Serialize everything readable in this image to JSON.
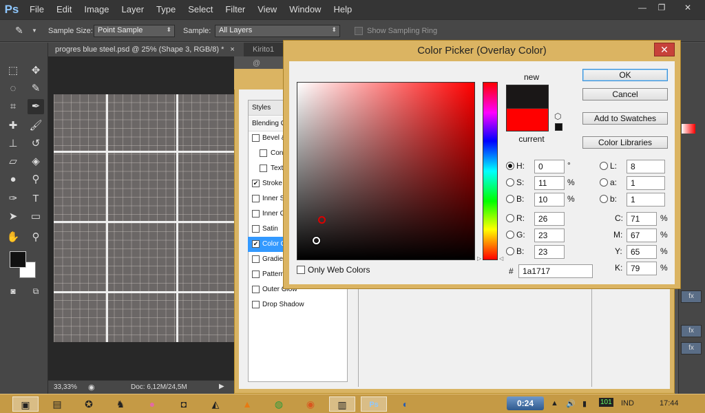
{
  "app": {
    "logo": "Ps",
    "menu": [
      "File",
      "Edit",
      "Image",
      "Layer",
      "Type",
      "Select",
      "Filter",
      "View",
      "Window",
      "Help"
    ],
    "window_buttons": [
      "minimize-icon",
      "restore-icon",
      "close-icon"
    ]
  },
  "options_bar": {
    "tool_icon": "eyedropper-icon",
    "sample_size_label": "Sample Size:",
    "sample_size_value": "Point Sample",
    "sample_label": "Sample:",
    "sample_value": "All Layers",
    "show_ring_label": "Show Sampling Ring",
    "show_ring_checked": false
  },
  "tabs": [
    {
      "label": "progres blue steel.psd @ 25% (Shape 3, RGB/8) *",
      "close": "×"
    },
    {
      "label": "Kirito1 @",
      "close": ""
    }
  ],
  "status": {
    "zoom": "33,33%",
    "doc": "Doc: 6,12M/24,5M"
  },
  "layer_style": {
    "styles_header": "Styles",
    "blending_label": "Blending O",
    "items": [
      {
        "label": "Bevel &",
        "checked": false,
        "indent": false
      },
      {
        "label": "Cont",
        "checked": false,
        "indent": true
      },
      {
        "label": "Text",
        "checked": false,
        "indent": true
      },
      {
        "label": "Stroke",
        "checked": true,
        "indent": false
      },
      {
        "label": "Inner S",
        "checked": false,
        "indent": false
      },
      {
        "label": "Inner G",
        "checked": false,
        "indent": false
      },
      {
        "label": "Satin",
        "checked": false,
        "indent": false
      },
      {
        "label": "Color O",
        "checked": true,
        "indent": false,
        "selected": true
      },
      {
        "label": "Gradien",
        "checked": false,
        "indent": false
      },
      {
        "label": "Pattern",
        "checked": false,
        "indent": false
      },
      {
        "label": "Outer Glow",
        "checked": false,
        "indent": false
      },
      {
        "label": "Drop Shadow",
        "checked": false,
        "indent": false
      }
    ]
  },
  "color_picker": {
    "title": "Color Picker (Overlay Color)",
    "close": "✕",
    "new_label": "new",
    "current_label": "current",
    "new_color": "#1a1717",
    "current_color": "#ff0000",
    "buttons": {
      "ok": "OK",
      "cancel": "Cancel",
      "add_swatches": "Add to Swatches",
      "libraries": "Color Libraries"
    },
    "hsb": {
      "h_label": "H:",
      "h_value": "0",
      "h_unit": "°",
      "s_label": "S:",
      "s_value": "11",
      "s_unit": "%",
      "b_label": "B:",
      "b_value": "10",
      "b_unit": "%"
    },
    "rgb": {
      "r_label": "R:",
      "r_value": "26",
      "g_label": "G:",
      "g_value": "23",
      "b_label": "B:",
      "b_value": "23"
    },
    "lab": {
      "l_label": "L:",
      "l_value": "8",
      "a_label": "a:",
      "a_value": "1",
      "b_label": "b:",
      "b_value": "1"
    },
    "cmyk": {
      "c_label": "C:",
      "c_value": "71",
      "c_unit": "%",
      "m_label": "M:",
      "m_value": "67",
      "m_unit": "%",
      "y_label": "Y:",
      "y_value": "65",
      "y_unit": "%",
      "k_label": "K:",
      "k_value": "79",
      "k_unit": "%"
    },
    "hex_label": "#",
    "hex_value": "1a1717",
    "web_only_label": "Only Web Colors",
    "web_only_checked": false,
    "selected_mode": "H"
  },
  "taskbar": {
    "video_time": "0:24",
    "lang": "IND",
    "clock": "17:44"
  }
}
